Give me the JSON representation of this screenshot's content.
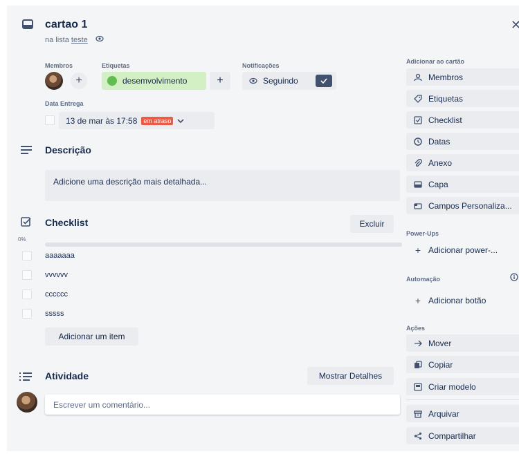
{
  "card": {
    "title": "cartao 1",
    "in_list_prefix": "na lista",
    "list_name": "teste"
  },
  "members": {
    "label": "Membros"
  },
  "labels": {
    "label": "Etiquetas",
    "tag": "desemvolvimento",
    "tag_color": "#61bd4f"
  },
  "notifications": {
    "label": "Notificações",
    "status": "Seguindo"
  },
  "due": {
    "label": "Data Entrega",
    "value": "13 de mar às 17:58",
    "badge": "em atraso"
  },
  "description": {
    "title": "Descrição",
    "placeholder": "Adicione uma descrição mais detalhada..."
  },
  "checklist": {
    "title": "Checklist",
    "delete_label": "Excluir",
    "progress_text": "0%",
    "progress": 0,
    "items": [
      "aaaaaaa",
      "vvvvvv",
      "cccccc",
      "sssss"
    ],
    "add_label": "Adicionar um item"
  },
  "activity": {
    "title": "Atividade",
    "details_label": "Mostrar Detalhes",
    "comment_placeholder": "Escrever um comentário..."
  },
  "sidebar": {
    "add_heading": "Adicionar ao cartão",
    "add_items": [
      "Membros",
      "Etiquetas",
      "Checklist",
      "Datas",
      "Anexo",
      "Capa",
      "Campos Personaliza..."
    ],
    "powerups_heading": "Power-Ups",
    "powerups_add": "Adicionar power-...",
    "automation_heading": "Automação",
    "automation_add": "Adicionar botão",
    "actions_heading": "Ações",
    "actions": [
      "Mover",
      "Copiar",
      "Criar modelo",
      "Arquivar",
      "Compartilhar"
    ]
  },
  "colors": {
    "accent": "#0079bf",
    "overdue": "#eb5a46",
    "label_green_bg": "#d3efc4"
  }
}
